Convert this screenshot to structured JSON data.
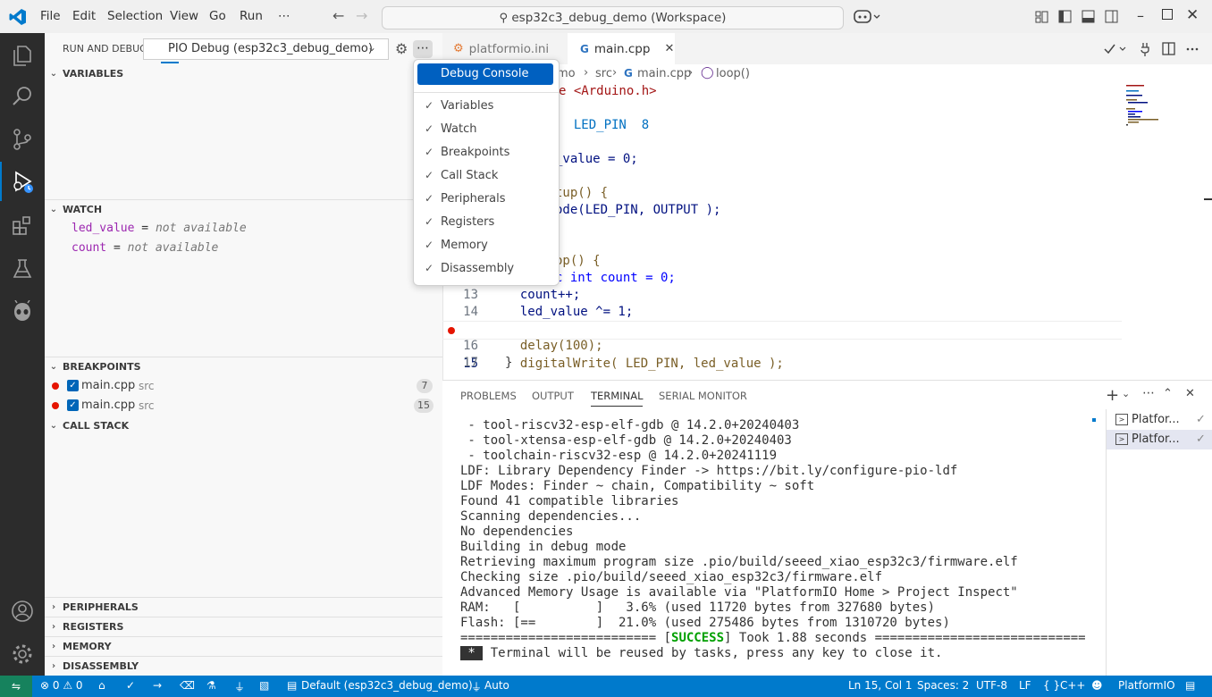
{
  "titlebar": {
    "menus": [
      "File",
      "Edit",
      "Selection",
      "View",
      "Go",
      "Run",
      "⋯"
    ],
    "command_center": "esp32c3_debug_demo (Workspace)"
  },
  "sidebar": {
    "title": "RUN AND DEBUG",
    "config": "PIO Debug (esp32c3_debug_demo)",
    "sections": {
      "variables": "VARIABLES",
      "watch": "WATCH",
      "breakpoints": "BREAKPOINTS",
      "callstack": "CALL STACK",
      "peripherals": "PERIPHERALS",
      "registers": "REGISTERS",
      "memory": "MEMORY",
      "disassembly": "DISASSEMBLY"
    },
    "watch_items": [
      {
        "name": "led_value",
        "eq": " = ",
        "value": "not available"
      },
      {
        "name": "count",
        "eq": " = ",
        "value": "not available"
      }
    ],
    "breakpoints": [
      {
        "file": "main.cpp",
        "dir": "src",
        "line": "7"
      },
      {
        "file": "main.cpp",
        "dir": "src",
        "line": "15"
      }
    ]
  },
  "menu": {
    "highlight": "Debug Console",
    "items": [
      "Variables",
      "Watch",
      "Breakpoints",
      "Call Stack",
      "Peripherals",
      "Registers",
      "Memory",
      "Disassembly"
    ]
  },
  "editor": {
    "tabs": [
      {
        "label": "platformio.ini",
        "active": false
      },
      {
        "label": "main.cpp",
        "active": true
      }
    ],
    "breadcrumb": [
      "mo",
      "src",
      "main.cpp",
      "loop()"
    ],
    "lines": [
      {
        "n": "",
        "t": "e <Arduino.h>"
      },
      {
        "n": "",
        "t": ""
      },
      {
        "n": "",
        "t": "  LED_PIN  8"
      },
      {
        "n": "",
        "t": ""
      },
      {
        "n": "",
        "t": "_value = 0;"
      },
      {
        "n": "",
        "t": ""
      },
      {
        "n": "",
        "t": "tup() {"
      },
      {
        "n": "",
        "t": "ode(LED_PIN, OUTPUT );"
      },
      {
        "n": "",
        "t": ""
      },
      {
        "n": "",
        "t": ""
      },
      {
        "n": "",
        "t": "op() {"
      },
      {
        "n": "",
        "t": "c int count = 0;"
      },
      {
        "n": "13",
        "t": "  count++;"
      },
      {
        "n": "14",
        "t": "  led_value ^= 1;"
      },
      {
        "n": "15",
        "t": "  digitalWrite( LED_PIN, led_value );"
      },
      {
        "n": "16",
        "t": "  delay(100);"
      },
      {
        "n": "17",
        "t": "}"
      }
    ]
  },
  "panel": {
    "tabs": [
      "PROBLEMS",
      "OUTPUT",
      "TERMINAL",
      "SERIAL MONITOR"
    ],
    "active_tab": "TERMINAL",
    "terminals": [
      "Platfor...",
      "Platfor..."
    ],
    "lines": [
      " - tool-riscv32-esp-elf-gdb @ 14.2.0+20240403",
      " - tool-xtensa-esp-elf-gdb @ 14.2.0+20240403",
      " - toolchain-riscv32-esp @ 14.2.0+20241119",
      "LDF: Library Dependency Finder -> https://bit.ly/configure-pio-ldf",
      "LDF Modes: Finder ~ chain, Compatibility ~ soft",
      "Found 41 compatible libraries",
      "Scanning dependencies...",
      "No dependencies",
      "Building in debug mode",
      "Retrieving maximum program size .pio/build/seeed_xiao_esp32c3/firmware.elf",
      "Checking size .pio/build/seeed_xiao_esp32c3/firmware.elf",
      "Advanced Memory Usage is available via \"PlatformIO Home > Project Inspect\"",
      "RAM:   [          ]   3.6% (used 11720 bytes from 327680 bytes)",
      "Flash: [==        ]  21.0% (used 275486 bytes from 1310720 bytes)"
    ],
    "success_pre": "========================== [",
    "success_word": "SUCCESS",
    "success_post": "] Took 1.88 seconds ============================",
    "reuse_star": " * ",
    "reuse_text": " Terminal will be reused by tasks, press any key to close it."
  },
  "status": {
    "problems": "⊗ 0 ⚠ 0",
    "env": "Default (esp32c3_debug_demo)",
    "auto": "Auto",
    "position": "Ln 15, Col 1",
    "spaces": "Spaces: 2",
    "encoding": "UTF-8",
    "eol": "LF",
    "lang": "C++",
    "platform": "PlatformIO"
  },
  "colors": {
    "accent": "#007acc",
    "breakpoint": "#e51400",
    "menu_highlight": "#0060c0"
  }
}
